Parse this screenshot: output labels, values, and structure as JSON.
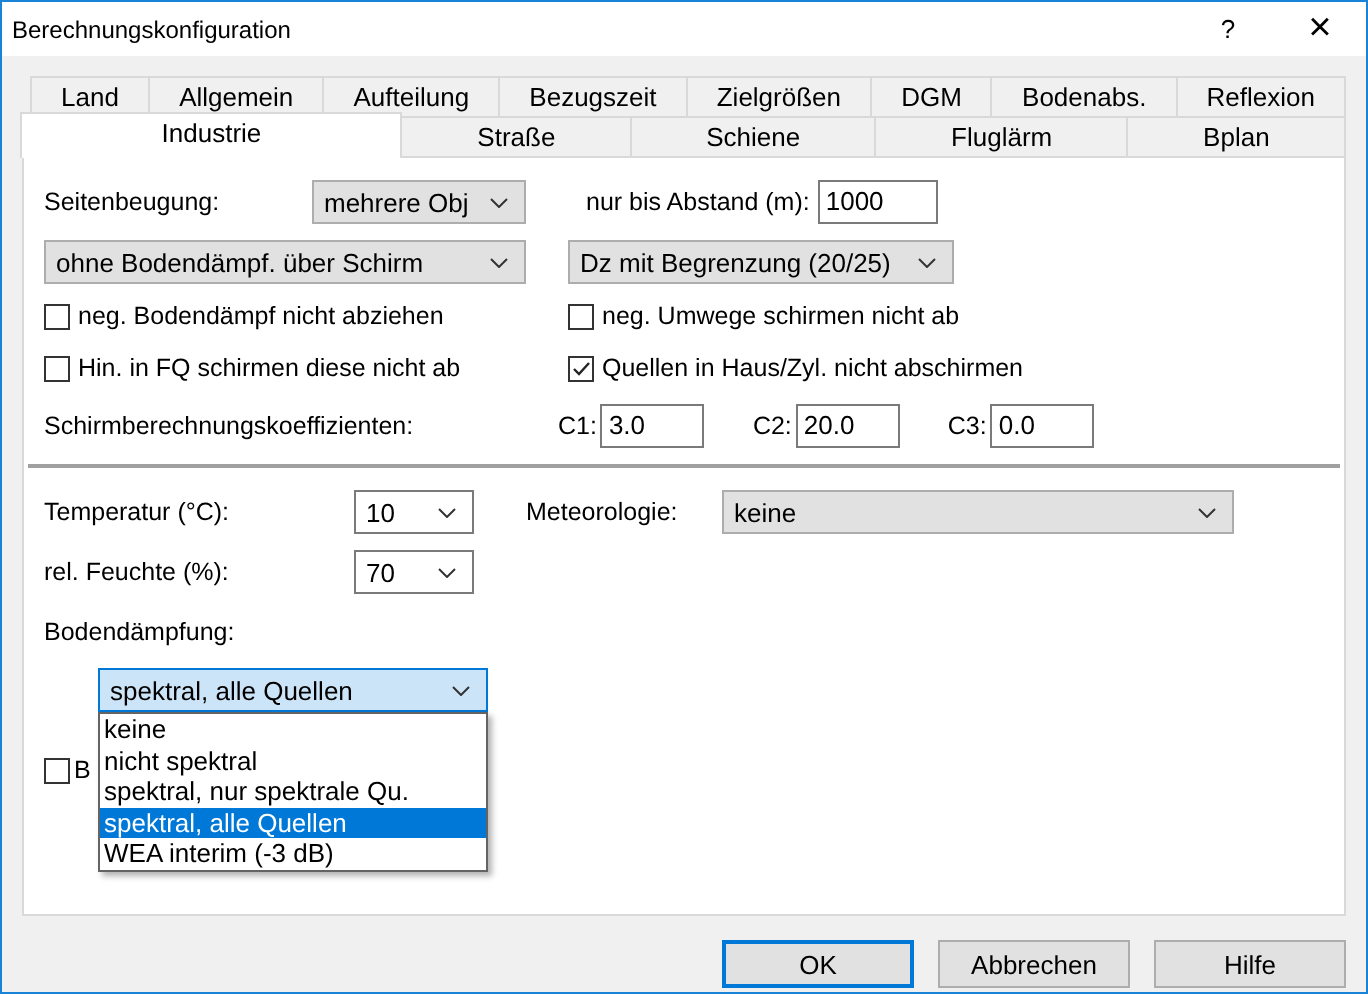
{
  "window": {
    "title": "Berechnungskonfiguration",
    "help": "?",
    "close": "×"
  },
  "tabs": {
    "row_1": [
      {
        "label": "Land",
        "selected": false
      },
      {
        "label": "Allgemein",
        "selected": false
      },
      {
        "label": "Aufteilung",
        "selected": false
      },
      {
        "label": "Bezugszeit",
        "selected": false
      },
      {
        "label": "Zielgrößen",
        "selected": false
      },
      {
        "label": "DGM",
        "selected": false
      },
      {
        "label": "Bodenabs.",
        "selected": false
      },
      {
        "label": "Reflexion",
        "selected": false
      }
    ],
    "row_2": [
      {
        "label": "Industrie",
        "selected": true
      },
      {
        "label": "Straße",
        "selected": false
      },
      {
        "label": "Schiene",
        "selected": false
      },
      {
        "label": "Fluglärm",
        "selected": false
      },
      {
        "label": "Bplan",
        "selected": false
      }
    ]
  },
  "seitenbeugung": {
    "label": "Seitenbeugung:",
    "value": "mehrere Obj",
    "kind": "list"
  },
  "abstand": {
    "label": "nur bis Abstand (m):",
    "value": "1000"
  },
  "schirm_modus": {
    "value": "ohne Bodendämpf. über Schirm",
    "kind": "list"
  },
  "dz": {
    "value": "Dz mit Begrenzung (20/25)",
    "kind": "list"
  },
  "checkboxes": [
    {
      "label": "neg. Bodendämpf nicht abziehen",
      "checked": false
    },
    {
      "label": "neg. Umwege schirmen nicht ab",
      "checked": false
    },
    {
      "label": "Hin. in FQ schirmen diese nicht ab",
      "checked": false
    },
    {
      "label": "Quellen in Haus/Zyl. nicht abschirmen",
      "checked": true
    }
  ],
  "koeffizienten": {
    "label": "Schirmberechnungskoeffizienten:",
    "fields": [
      {
        "label": "C1:",
        "value": "3.0"
      },
      {
        "label": "C2:",
        "value": "20.0"
      },
      {
        "label": "C3:",
        "value": "0.0"
      }
    ]
  },
  "temperatur": {
    "label": "Temperatur (°C):",
    "value": "10",
    "kind": "combo"
  },
  "meteorologie": {
    "label": "Meteorologie:",
    "value": "keine",
    "kind": "list"
  },
  "feuchte": {
    "label": "rel. Feuchte (%):",
    "value": "70",
    "kind": "combo"
  },
  "bodendaempfung": {
    "label": "Bodendämpfung:",
    "value": "spektral, alle Quellen",
    "kind": "combo",
    "expanded": true,
    "options": [
      {
        "label": "keine",
        "selected": false
      },
      {
        "label": "nicht spektral",
        "selected": false
      },
      {
        "label": "spektral, nur spektrale Qu.",
        "selected": false
      },
      {
        "label": "spektral, alle Quellen",
        "selected": true
      },
      {
        "label": "WEA interim (-3 dB)",
        "selected": false
      }
    ]
  },
  "covered_checkbox": {
    "label": "B",
    "checked": false
  },
  "buttons": [
    {
      "label": "OK",
      "default": true
    },
    {
      "label": "Abbrechen",
      "default": false
    },
    {
      "label": "Hilfe",
      "default": false
    }
  ]
}
